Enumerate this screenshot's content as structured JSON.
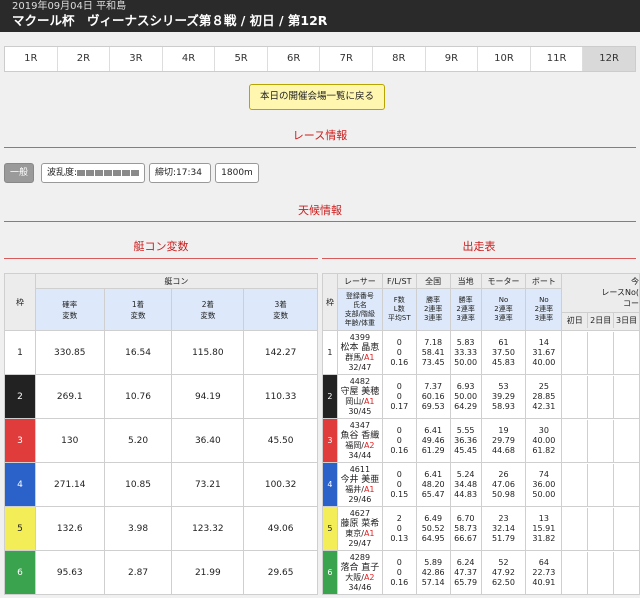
{
  "header": {
    "date": "2019年09月04日 平和島",
    "title": "マクール杯　ヴィーナスシリーズ第８戦 / 初日 / 第12R"
  },
  "race_tabs": [
    "1R",
    "2R",
    "3R",
    "4R",
    "5R",
    "6R",
    "7R",
    "8R",
    "9R",
    "10R",
    "11R",
    "12R"
  ],
  "active_tab": "12R",
  "back_button": "本日の開催会場一覧に戻る",
  "sections": {
    "race_info": "レース情報",
    "weather": "天候情報",
    "boat_comp": "艇コン変数",
    "entries": "出走表"
  },
  "race_info": {
    "class": "一般",
    "wave_label": "波乱度:",
    "deadline": "締切:17:34",
    "distance": "1800m"
  },
  "left_table": {
    "group_header": "艇コン",
    "col_waku": "枠",
    "cols": [
      "確率\n変数",
      "1着\n変数",
      "2着\n変数",
      "3着\n変数"
    ],
    "rows": [
      {
        "waku": "1",
        "vals": [
          "330.85",
          "16.54",
          "115.80",
          "142.27"
        ]
      },
      {
        "waku": "2",
        "vals": [
          "269.1",
          "10.76",
          "94.19",
          "110.33"
        ]
      },
      {
        "waku": "3",
        "vals": [
          "130",
          "5.20",
          "36.40",
          "45.50"
        ]
      },
      {
        "waku": "4",
        "vals": [
          "271.14",
          "10.85",
          "73.21",
          "100.32"
        ]
      },
      {
        "waku": "5",
        "vals": [
          "132.6",
          "3.98",
          "123.32",
          "49.06"
        ]
      },
      {
        "waku": "6",
        "vals": [
          "95.63",
          "2.87",
          "21.99",
          "29.65"
        ]
      }
    ]
  },
  "right_table": {
    "col_waku": "枠",
    "headers": [
      "レーサー",
      "F/L/ST",
      "全国",
      "当地",
      "モーター",
      "ボート"
    ],
    "subheaders": [
      "登録番号\n氏名\n支部/階級\n年齢/体重",
      "F数\nL数\n平均ST",
      "勝率\n2連率\n3連率",
      "勝率\n2連率\n3連率",
      "No\n2連率\n3連率",
      "No\n2連率\n3連率"
    ],
    "extra_header_top": "今",
    "extra_header_mid": "レースNo(",
    "extra_header_bot": "コー",
    "day_headers": [
      "初日",
      "2日目",
      "3日目"
    ],
    "rows": [
      {
        "waku": "1",
        "reg": "4399",
        "name": "松本 晶恵",
        "branch": "群馬/",
        "cls": "A1",
        "age": "32/47",
        "fl": [
          "0",
          "0",
          "0.16"
        ],
        "nat": [
          "7.18",
          "58.41",
          "73.45"
        ],
        "loc": [
          "5.83",
          "33.33",
          "50.00"
        ],
        "mot": [
          "61",
          "37.50",
          "45.83"
        ],
        "boat": [
          "14",
          "31.67",
          "40.00"
        ]
      },
      {
        "waku": "2",
        "reg": "4482",
        "name": "守屋 美穂",
        "branch": "岡山/",
        "cls": "A1",
        "age": "30/45",
        "fl": [
          "0",
          "0",
          "0.17"
        ],
        "nat": [
          "7.37",
          "60.16",
          "69.53"
        ],
        "loc": [
          "6.93",
          "50.00",
          "64.29"
        ],
        "mot": [
          "53",
          "39.29",
          "58.93"
        ],
        "boat": [
          "25",
          "28.85",
          "42.31"
        ]
      },
      {
        "waku": "3",
        "reg": "4347",
        "name": "魚谷 香織",
        "branch": "福岡/",
        "cls": "A2",
        "age": "34/44",
        "fl": [
          "0",
          "0",
          "0.16"
        ],
        "nat": [
          "6.41",
          "49.46",
          "61.29"
        ],
        "loc": [
          "5.55",
          "36.36",
          "45.45"
        ],
        "mot": [
          "19",
          "29.79",
          "44.68"
        ],
        "boat": [
          "30",
          "40.00",
          "61.82"
        ]
      },
      {
        "waku": "4",
        "reg": "4611",
        "name": "今井 美亜",
        "branch": "福井/",
        "cls": "A1",
        "age": "29/46",
        "fl": [
          "0",
          "0",
          "0.15"
        ],
        "nat": [
          "6.41",
          "48.20",
          "65.47"
        ],
        "loc": [
          "5.24",
          "34.48",
          "44.83"
        ],
        "mot": [
          "26",
          "47.06",
          "50.98"
        ],
        "boat": [
          "74",
          "36.00",
          "50.00"
        ]
      },
      {
        "waku": "5",
        "reg": "4627",
        "name": "藤原 菜希",
        "branch": "東京/",
        "cls": "A1",
        "age": "29/47",
        "fl": [
          "2",
          "0",
          "0.13"
        ],
        "nat": [
          "6.49",
          "50.52",
          "64.95"
        ],
        "loc": [
          "6.70",
          "58.73",
          "66.67"
        ],
        "mot": [
          "23",
          "32.14",
          "51.79"
        ],
        "boat": [
          "13",
          "15.91",
          "31.82"
        ]
      },
      {
        "waku": "6",
        "reg": "4289",
        "name": "落合 直子",
        "branch": "大阪/",
        "cls": "A2",
        "age": "34/46",
        "fl": [
          "0",
          "0",
          "0.16"
        ],
        "nat": [
          "5.89",
          "42.86",
          "57.14"
        ],
        "loc": [
          "6.24",
          "47.37",
          "65.79"
        ],
        "mot": [
          "52",
          "47.92",
          "62.50"
        ],
        "boat": [
          "64",
          "22.73",
          "40.91"
        ]
      }
    ]
  }
}
